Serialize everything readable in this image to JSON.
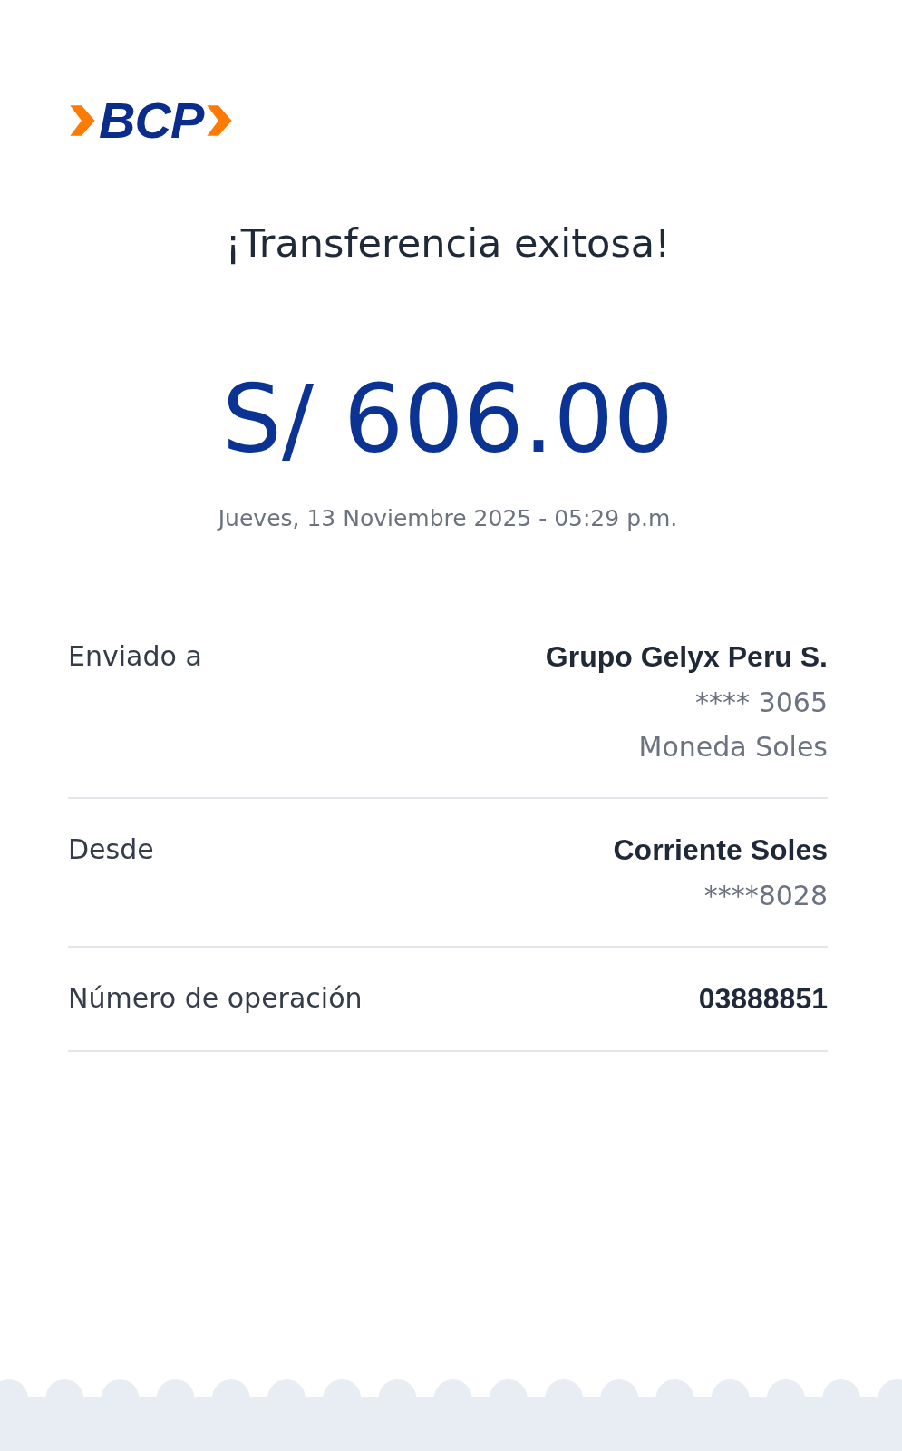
{
  "logo": {
    "text": "BCP"
  },
  "title": "¡Transferencia exitosa!",
  "amount": "S/ 606.00",
  "datetime": "Jueves, 13 Noviembre 2025 - 05:29 p.m.",
  "details": [
    {
      "label": "Enviado a",
      "lines": [
        {
          "text": "Grupo Gelyx Peru S.",
          "kind": "strong"
        },
        {
          "text": "**** 3065",
          "kind": "muted"
        },
        {
          "text": "Moneda Soles",
          "kind": "muted"
        }
      ]
    },
    {
      "label": "Desde",
      "lines": [
        {
          "text": "Corriente Soles",
          "kind": "strong"
        },
        {
          "text": "****8028",
          "kind": "muted"
        }
      ]
    },
    {
      "label": "Número de operación",
      "lines": [
        {
          "text": "03888851",
          "kind": "strong"
        }
      ]
    }
  ]
}
